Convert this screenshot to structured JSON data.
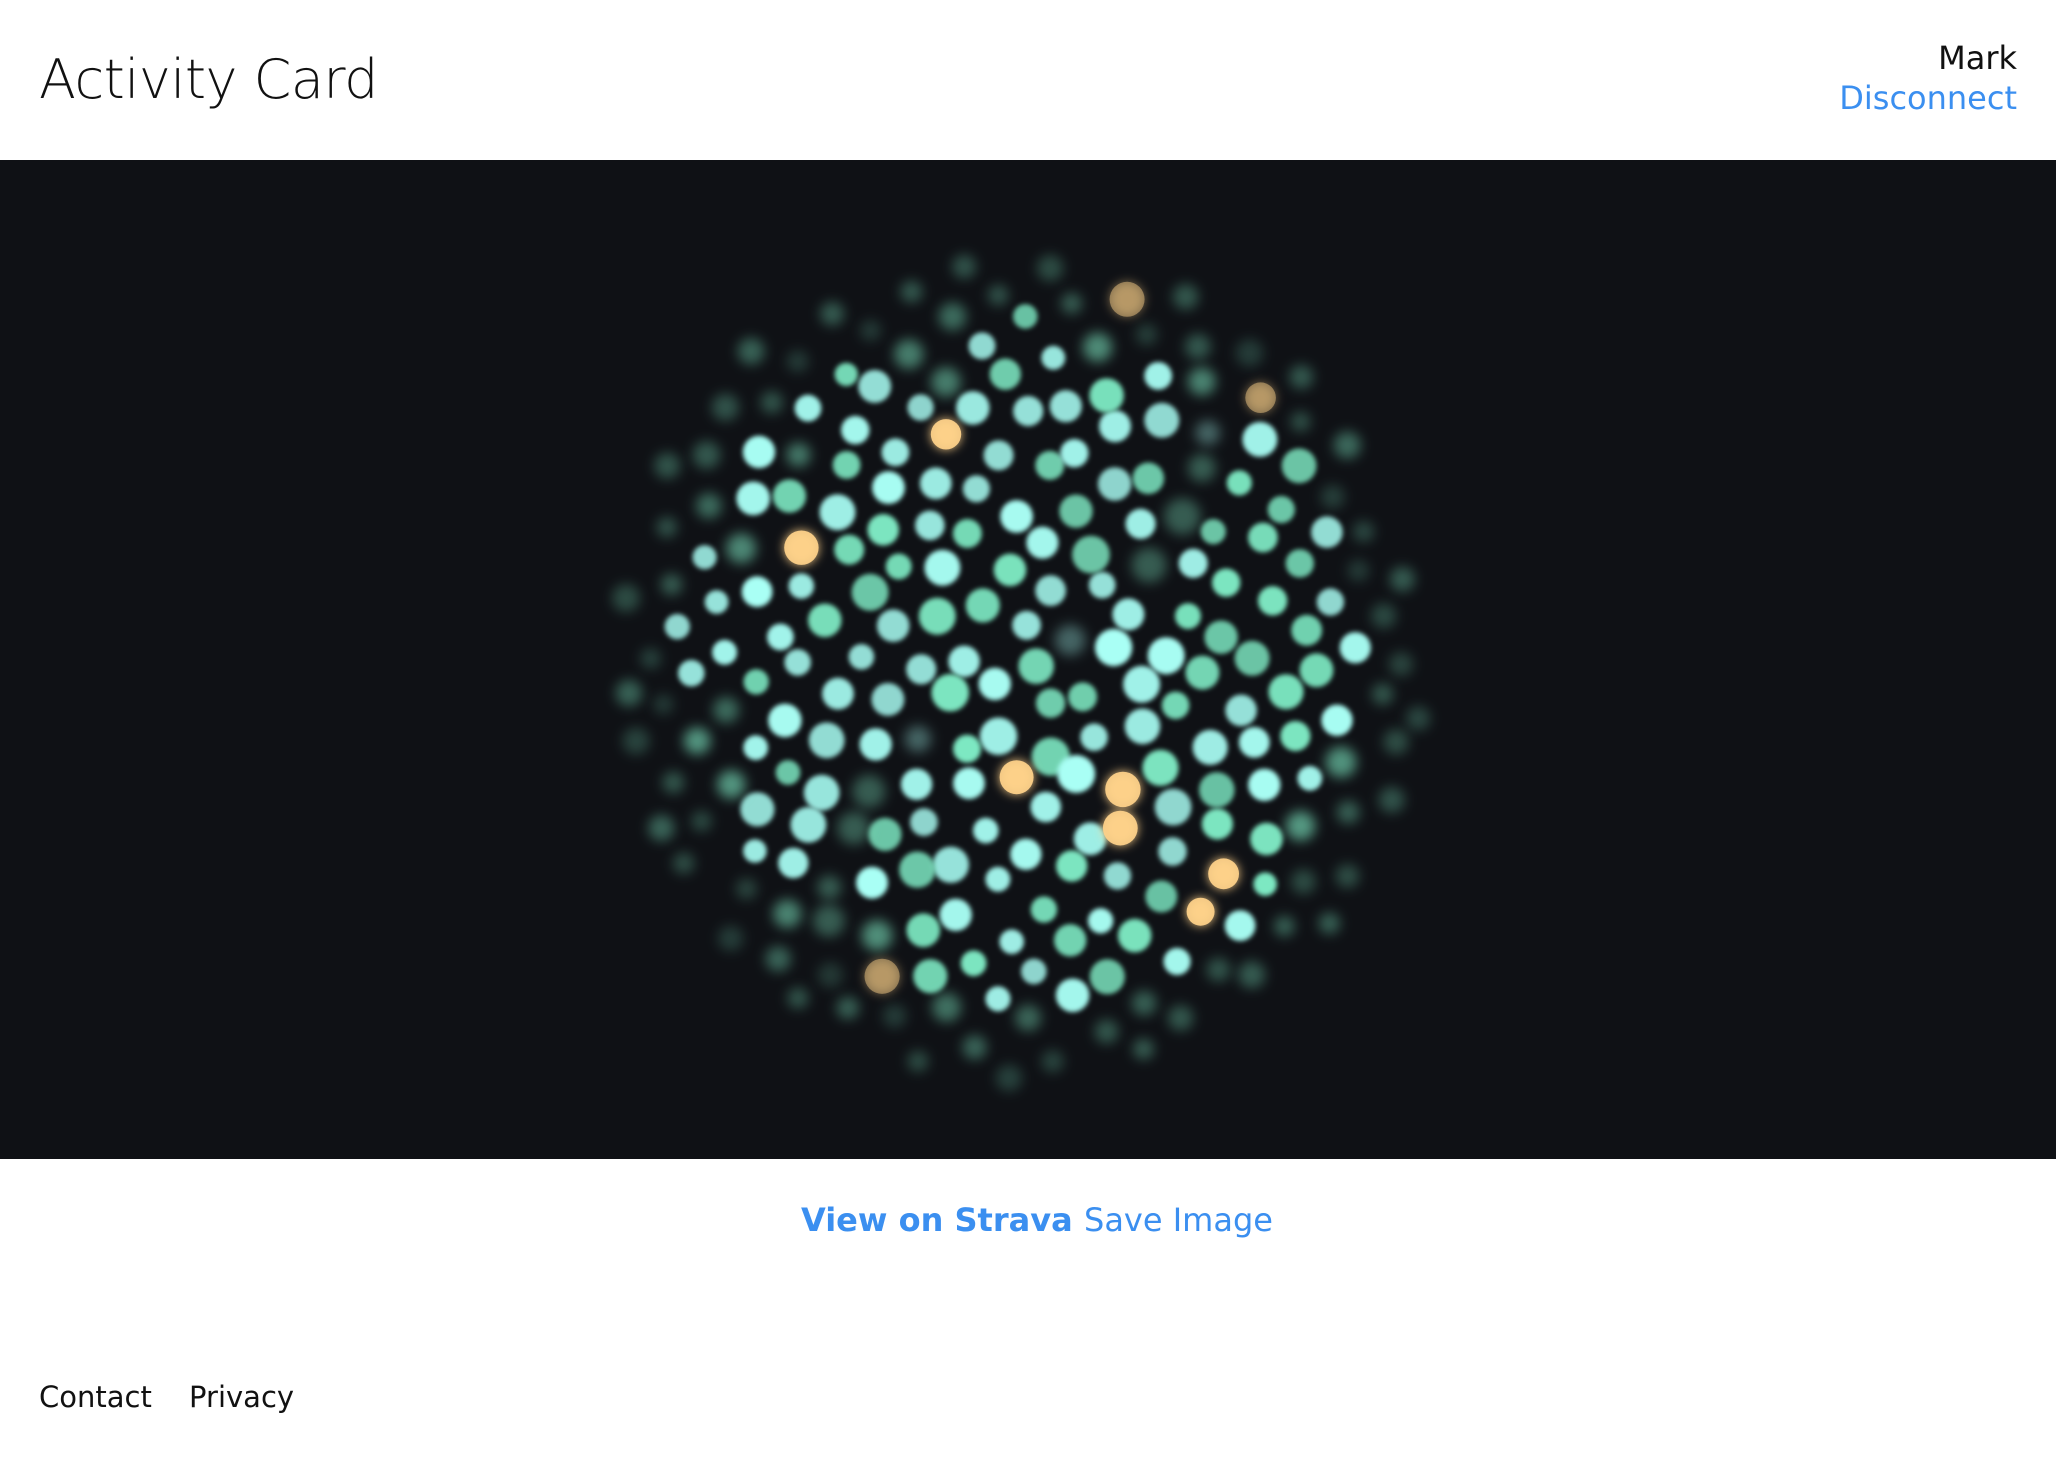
{
  "header": {
    "title": "Activity Card",
    "user_name": "Mark",
    "disconnect_label": "Disconnect"
  },
  "art": {
    "background": "#0f1115",
    "dot_colors": {
      "primary": "#a9fff5",
      "secondary": "#7de8c2",
      "highlight": "#ffd38a"
    }
  },
  "actions": {
    "view_label": "View on Strava",
    "save_label": "Save Image"
  },
  "footer": {
    "links": [
      "Contact",
      "Privacy"
    ]
  },
  "colors": {
    "link": "#3b8ff0",
    "text": "#111111"
  }
}
